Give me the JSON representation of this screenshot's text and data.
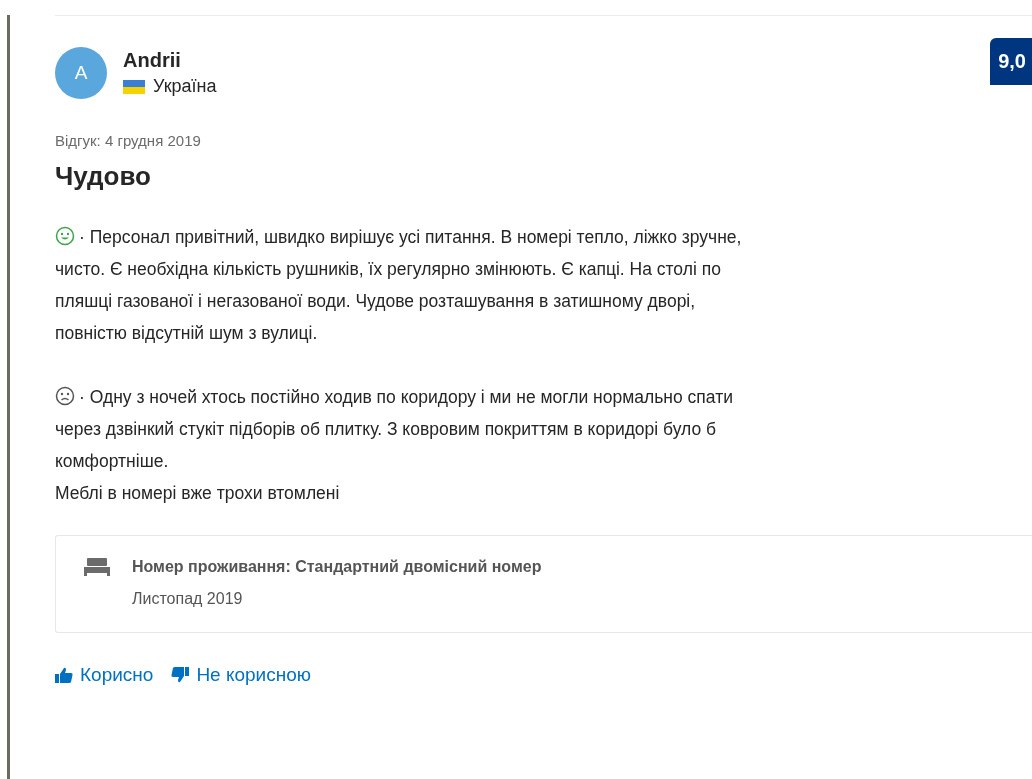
{
  "reviewer": {
    "initial": "A",
    "name": "Andrii",
    "country": "Україна"
  },
  "score": "9,0",
  "review_date": "Відгук: 4 грудня 2019",
  "title": "Чудово",
  "comments": [
    {
      "kind": "positive",
      "text": "· Персонал привітний, швидко вирішує усі питання. В номері тепло, ліжко зручне,\nчисто. Є необхідна кількість рушників, їх регулярно змінюють. Є капці. На столі по\nпляшці газованої і негазованої води. Чудове розташування в затишному дворі,\nповністю відсутній шум з вулиці."
    },
    {
      "kind": "negative",
      "text": "· Одну з ночей хтось постійно ходив по коридору і ми не могли нормально спати\nчерез дзвінкий стукіт підборів об плитку. З ковровим покриттям в коридорі було б\nкомфортніше.\nМеблі в номері вже трохи втомлені"
    }
  ],
  "stay": {
    "room": "Номер проживання: Стандартний двомісний номер",
    "date": "Листопад 2019"
  },
  "actions": [
    {
      "kind": "helpful",
      "label": "Корисно"
    },
    {
      "kind": "unhelpful",
      "label": "Не корисною"
    }
  ]
}
